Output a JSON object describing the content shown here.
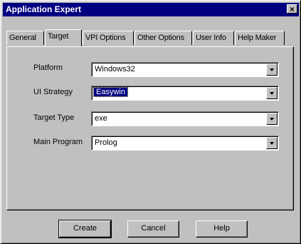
{
  "window": {
    "title": "Application Expert",
    "close_glyph": "×"
  },
  "tabs": [
    {
      "label": "General",
      "active": false
    },
    {
      "label": "Target",
      "active": true
    },
    {
      "label": "VPI Options",
      "active": false
    },
    {
      "label": "Other Options",
      "active": false
    },
    {
      "label": "User Info",
      "active": false
    },
    {
      "label": "Help Maker",
      "active": false
    }
  ],
  "fields": {
    "platform": {
      "label": "Platform",
      "value": "Windows32"
    },
    "ui_strategy": {
      "label": "UI Strategy",
      "value": "Easywin"
    },
    "target_type": {
      "label": "Target Type",
      "value": "exe"
    },
    "main_program": {
      "label": "Main Program",
      "value": "Prolog"
    }
  },
  "buttons": {
    "create": "Create",
    "cancel": "Cancel",
    "help": "Help"
  },
  "icons": {
    "dropdown": "chevron-down-icon",
    "close": "close-icon"
  },
  "colors": {
    "titlebar": "#000080",
    "face": "#c0c0c0",
    "highlight": "#000080"
  }
}
